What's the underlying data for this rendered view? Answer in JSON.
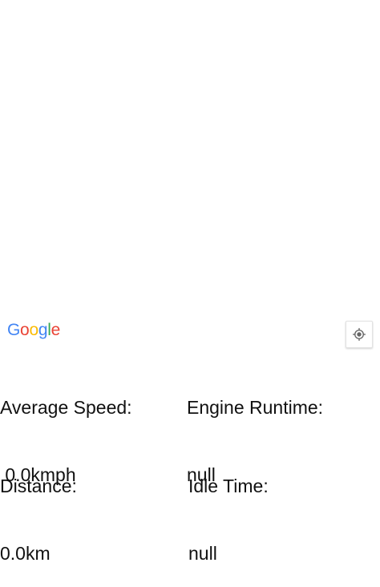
{
  "map": {
    "logo_letters": [
      {
        "char": "G",
        "color": "#4285F4"
      },
      {
        "char": "o",
        "color": "#EA4335"
      },
      {
        "char": "o",
        "color": "#FBBC05"
      },
      {
        "char": "g",
        "color": "#4285F4"
      },
      {
        "char": "l",
        "color": "#34A853"
      },
      {
        "char": "e",
        "color": "#EA4335"
      }
    ],
    "my_location_icon": "my-location-icon"
  },
  "stats": {
    "average_speed": {
      "label": "Average Speed:",
      "value": " 0.0kmph"
    },
    "engine_runtime": {
      "label": "Engine Runtime:",
      "value": "null"
    },
    "distance": {
      "label": "Distance:",
      "value": "0.0km"
    },
    "idle_time": {
      "label": "Idle Time:",
      "value": "null"
    }
  }
}
